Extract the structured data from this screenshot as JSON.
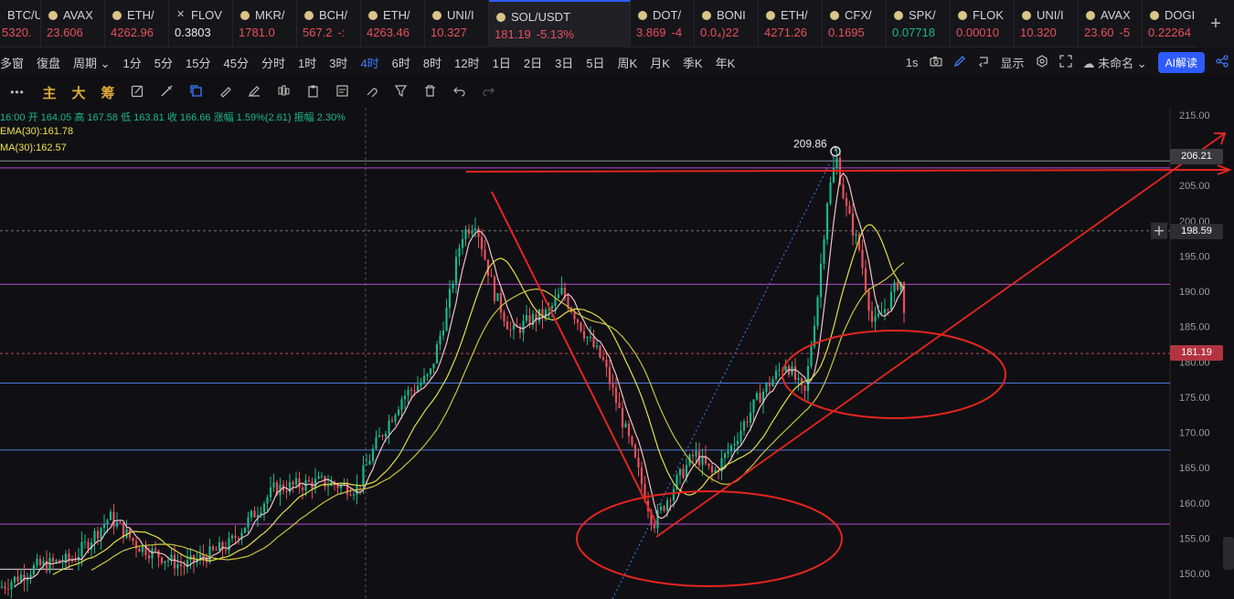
{
  "tickers": [
    {
      "symbol": "BTC/U",
      "price": "5320.",
      "change": "",
      "dir": "dn",
      "coin": "dot"
    },
    {
      "symbol": "AVAX",
      "price": "23.606",
      "change": "",
      "dir": "dn",
      "coin": "dot"
    },
    {
      "symbol": "ETH/",
      "price": "4262.96",
      "change": "",
      "dir": "dn",
      "coin": "dot"
    },
    {
      "symbol": "FLOV",
      "price": "0.3803",
      "change": "",
      "dir": "wht",
      "coin": "x"
    },
    {
      "symbol": "MKR/",
      "price": "1781.0",
      "change": "",
      "dir": "dn",
      "coin": "dot"
    },
    {
      "symbol": "BCH/",
      "price": "567.2",
      "change": "-:",
      "dir": "dn",
      "coin": "dot"
    },
    {
      "symbol": "ETH/",
      "price": "4263.46",
      "change": "",
      "dir": "dn",
      "coin": "dot"
    },
    {
      "symbol": "UNI/I",
      "price": "10.327",
      "change": "",
      "dir": "dn",
      "coin": "dot"
    },
    {
      "symbol": "SOL/USDT",
      "price": "181.19",
      "change": "-5.13%",
      "dir": "dn",
      "coin": "dot",
      "active": true
    },
    {
      "symbol": "DOT/",
      "price": "3.869",
      "change": "-4",
      "dir": "dn",
      "coin": "dot"
    },
    {
      "symbol": "BONI",
      "price": "0.0₄)22",
      "change": "",
      "dir": "dn",
      "coin": "dot"
    },
    {
      "symbol": "ETH/",
      "price": "4271.26",
      "change": "",
      "dir": "dn",
      "coin": "dot"
    },
    {
      "symbol": "CFX/",
      "price": "0.1695",
      "change": "",
      "dir": "dn",
      "coin": "dot"
    },
    {
      "symbol": "SPK/",
      "price": "0.07718",
      "change": "",
      "dir": "up",
      "coin": "dot"
    },
    {
      "symbol": "FLOK",
      "price": "0.00010",
      "change": "",
      "dir": "dn",
      "coin": "dot"
    },
    {
      "symbol": "UNI/I",
      "price": "10.320",
      "change": "",
      "dir": "dn",
      "coin": "dot"
    },
    {
      "symbol": "AVAX",
      "price": "23.60",
      "change": "-5",
      "dir": "dn",
      "coin": "dot"
    },
    {
      "symbol": "DOGI",
      "price": "0.22264",
      "change": "",
      "dir": "dn",
      "coin": "dot"
    }
  ],
  "plus_label": "+",
  "intervals": {
    "left": [
      "多窗",
      "復盘",
      "周期 ⌄",
      "1分",
      "5分",
      "15分",
      "45分",
      "分时",
      "1时",
      "3时",
      "4时",
      "6时",
      "8时",
      "12时",
      "1日",
      "2日",
      "3日",
      "5日",
      "周K",
      "月K",
      "季K",
      "年K"
    ],
    "selected": "4时",
    "right": [
      "1s",
      "显示",
      "未命名 ⌄"
    ],
    "ai_label": "AI解读"
  },
  "draw_tools": {
    "dots": "•••",
    "labels": [
      "主",
      "大",
      "筹"
    ]
  },
  "chart": {
    "ohlc_line": "16:00 开 164.05 高 167.58 低 163.81 收 166.66 涨幅 1.59%(2.61) 振幅 2.30%",
    "ema_label": "EMA(30):161.78",
    "ma_label": "MA(30):162.57",
    "ohlc_color": "#19b88a",
    "ema_color": "#f0e050",
    "ma_color": "#f0e050",
    "axis_ticks": [
      "215.00",
      "205.00",
      "200.00",
      "195.00",
      "190.00",
      "185.00",
      "180.00",
      "175.00",
      "170.00",
      "165.00",
      "160.00",
      "155.00",
      "150.00"
    ],
    "high_label": "209.86",
    "last_price": "181.19",
    "crosshair_price": "198.59",
    "level_price": "206.21",
    "colors": {
      "up": "#19b88a",
      "down": "#e8505b",
      "annotation": "#e5251f",
      "ma_yellow": "#e3df4a",
      "ma_pink": "#f4c0c8"
    }
  }
}
